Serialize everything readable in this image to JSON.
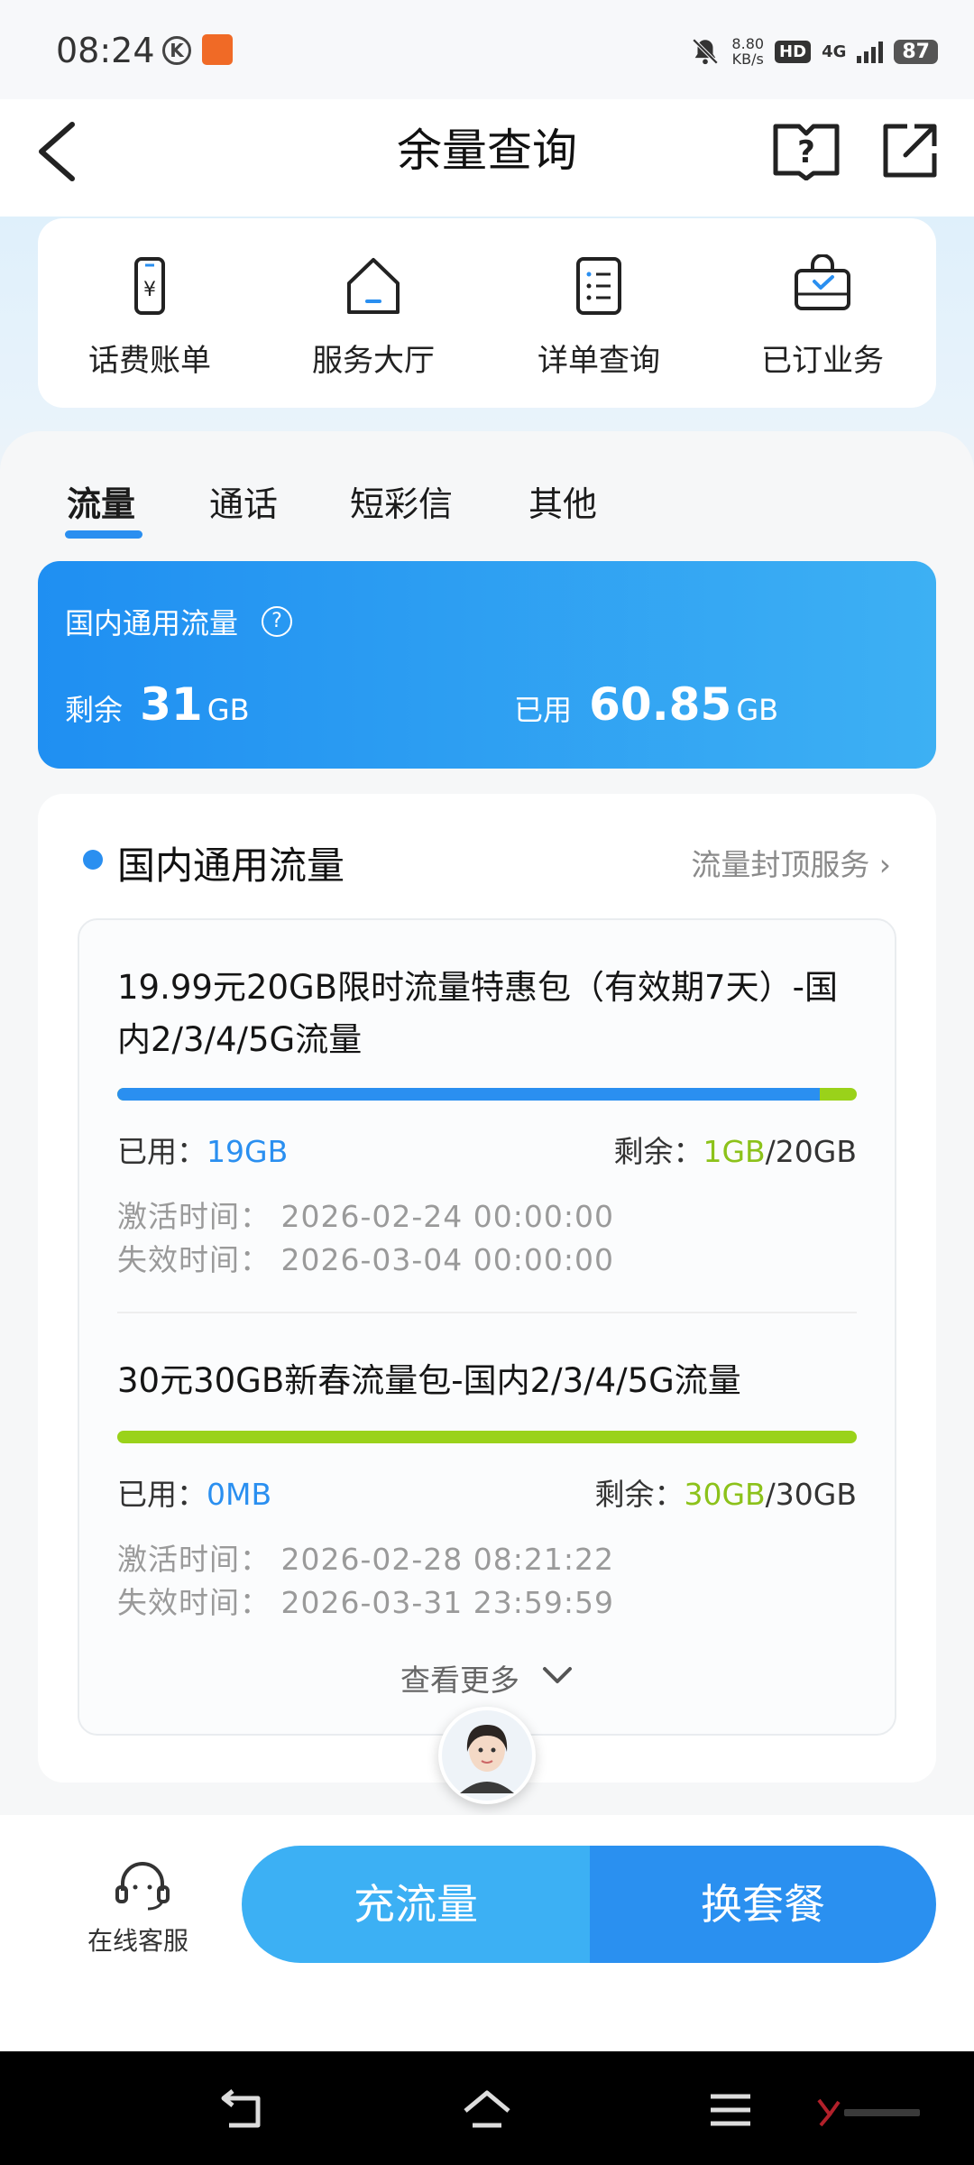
{
  "status_bar": {
    "time": "08:24",
    "speed_value": "8.80",
    "speed_unit": "KB/s",
    "hd": "HD",
    "network": "4G",
    "battery": "87"
  },
  "header": {
    "title": "余量查询"
  },
  "quick_actions": [
    {
      "label": "话费账单",
      "icon": "bill-phone-icon"
    },
    {
      "label": "服务大厅",
      "icon": "house-icon"
    },
    {
      "label": "详单查询",
      "icon": "list-document-icon"
    },
    {
      "label": "已订业务",
      "icon": "bag-check-icon"
    }
  ],
  "tabs": [
    {
      "label": "流量",
      "active": true
    },
    {
      "label": "通话",
      "active": false
    },
    {
      "label": "短彩信",
      "active": false
    },
    {
      "label": "其他",
      "active": false
    }
  ],
  "summary": {
    "title": "国内通用流量",
    "remain_label": "剩余",
    "remain_value": "31",
    "remain_unit": "GB",
    "used_label": "已用",
    "used_value": "60.85",
    "used_unit": "GB"
  },
  "detail": {
    "title": "国内通用流量",
    "cap_link": "流量封顶服务 ›",
    "packages": [
      {
        "name": "19.99元20GB限时流量特惠包（有效期7天）-国内2/3/4/5G流量",
        "used_label": "已用：",
        "used": "19GB",
        "remain_label": "剩余：",
        "remain": "1GB",
        "total": "/20GB",
        "used_fraction": 0.95,
        "activate": "激活时间：  2026-02-24  00:00:00",
        "expire": "失效时间：  2026-03-04  00:00:00"
      },
      {
        "name": "30元30GB新春流量包-国内2/3/4/5G流量",
        "used_label": "已用：",
        "used": "0MB",
        "remain_label": "剩余：",
        "remain": "30GB",
        "total": "/30GB",
        "used_fraction": 0.0,
        "activate": "激活时间：  2026-02-28  08:21:22",
        "expire": "失效时间：  2026-03-31  23:59:59"
      }
    ],
    "more": "查看更多"
  },
  "bottom": {
    "customer_service": "在线客服",
    "recharge": "充流量",
    "change_plan": "换套餐"
  },
  "colors": {
    "primary": "#2a8ff0",
    "accent_light": "#3cb0f4",
    "remain_green": "#8cc21a",
    "bar_green": "#9ad21a"
  }
}
